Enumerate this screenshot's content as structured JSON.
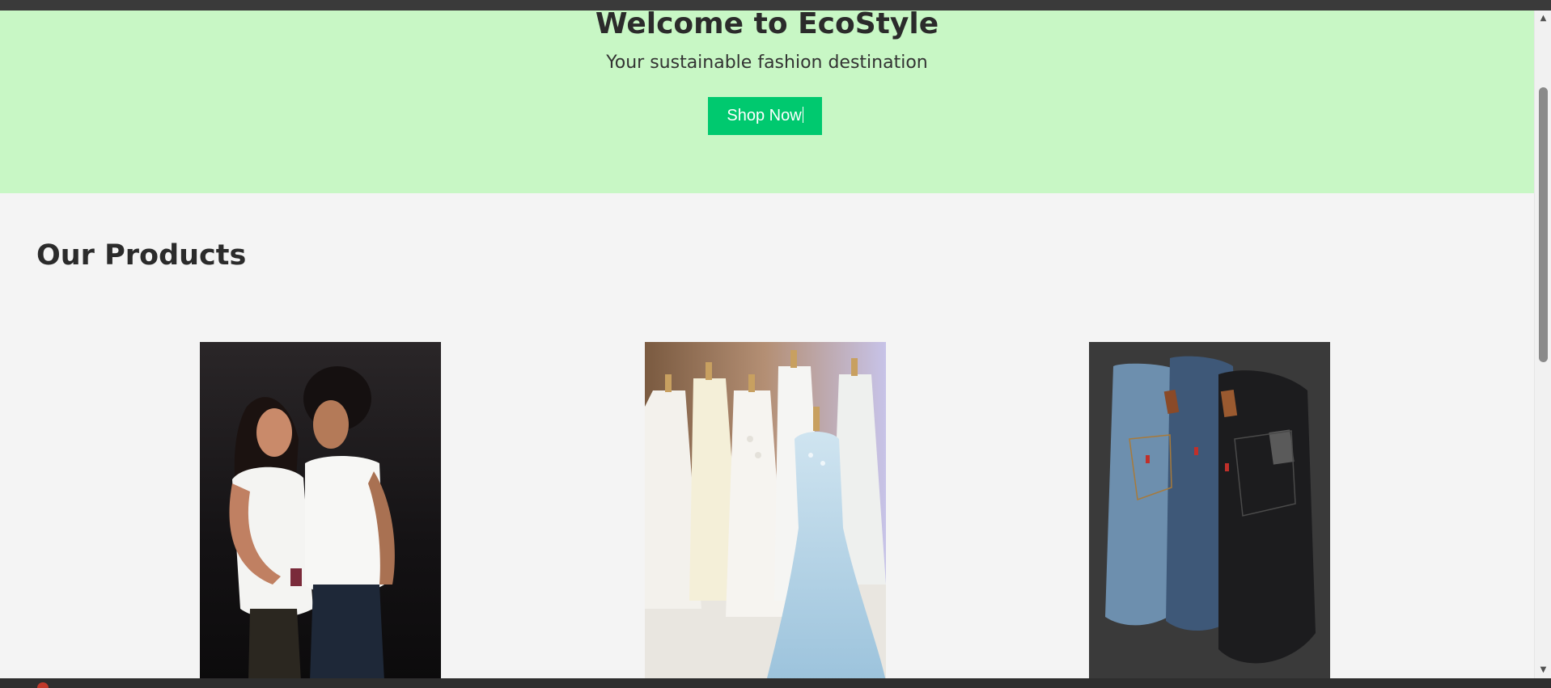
{
  "hero": {
    "title": "Welcome to EcoStyle",
    "subtitle": "Your sustainable fashion destination",
    "cta_label": "Shop Now",
    "background_color": "#c8f7c5",
    "cta_color": "#00c96f"
  },
  "products": {
    "heading": "Our Products",
    "items": [
      {
        "image": "couple-white-tshirts-photo"
      },
      {
        "image": "wedding-dresses-mannequins-photo"
      },
      {
        "image": "folded-jeans-photo"
      }
    ]
  },
  "scrollbar": {
    "up_icon": "scroll-up-arrow-icon",
    "down_icon": "scroll-down-arrow-icon"
  }
}
